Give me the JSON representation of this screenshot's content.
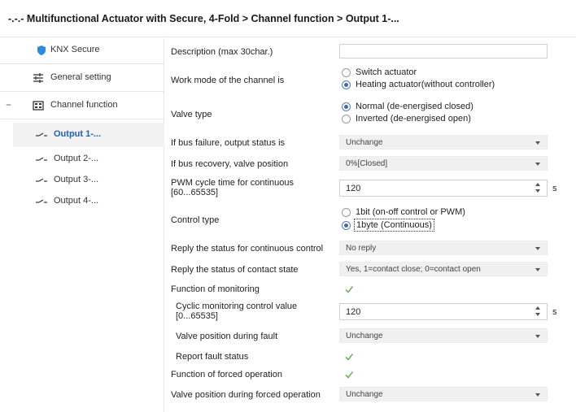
{
  "window": {
    "title": "-.-.- Multifunctional Actuator with Secure, 4-Fold > Channel function > Output 1-..."
  },
  "sidebar": {
    "items": [
      {
        "label": "KNX Secure",
        "icon": "shield-icon"
      },
      {
        "label": "General setting",
        "icon": "sliders-icon"
      },
      {
        "label": "Channel function",
        "icon": "grid-icon",
        "expander": "−"
      },
      {
        "label": "Output 1-...",
        "icon": "switch-icon",
        "selected": true
      },
      {
        "label": "Output 2-...",
        "icon": "switch-icon"
      },
      {
        "label": "Output 3-...",
        "icon": "switch-icon"
      },
      {
        "label": "Output 4-...",
        "icon": "switch-icon"
      }
    ]
  },
  "form": {
    "description": {
      "label": "Description (max 30char.)",
      "value": ""
    },
    "work_mode": {
      "label": "Work mode of the channel is",
      "options": [
        "Switch actuator",
        "Heating actuator(without controller)"
      ],
      "selected_index": 1
    },
    "valve_type": {
      "label": "Valve type",
      "options": [
        "Normal (de-energised closed)",
        "Inverted (de-energised open)"
      ],
      "selected_index": 0
    },
    "bus_failure": {
      "label": "If bus failure, output status is",
      "value": "Unchange"
    },
    "bus_recovery": {
      "label": "If bus recovery, valve position",
      "value": "0%[Closed]"
    },
    "pwm_cycle": {
      "label": "PWM cycle time for continuous [60...65535]",
      "label_line1": "PWM cycle time for continuous",
      "label_line2": "[60...65535]",
      "value": "120",
      "unit": "s"
    },
    "control_type": {
      "label": "Control type",
      "options": [
        "1bit (on-off control or PWM)",
        "1byte (Continuous)"
      ],
      "selected_index": 1
    },
    "reply_continuous": {
      "label": "Reply the status for continuous control",
      "value": "No reply"
    },
    "reply_contact": {
      "label": "Reply the status of contact state",
      "value": "Yes, 1=contact close; 0=contact open"
    },
    "monitoring": {
      "label": "Function of monitoring",
      "checked": true
    },
    "cyclic_monitoring": {
      "label_line1": "Cyclic monitoring control value",
      "label_line2": "[0...65535]",
      "value": "120",
      "unit": "s"
    },
    "valve_fault": {
      "label": "Valve position during fault",
      "value": "Unchange"
    },
    "report_fault": {
      "label": "Report fault status",
      "checked": true
    },
    "forced_operation": {
      "label": "Function of forced operation",
      "checked": true
    },
    "valve_forced": {
      "label": "Valve position during forced operation",
      "value": "Unchange"
    }
  },
  "colors": {
    "accent": "#3d6bb3",
    "selected_text": "#1f5fbf",
    "check_green": "#6cb35e",
    "shield_blue": "#2b8be0"
  }
}
